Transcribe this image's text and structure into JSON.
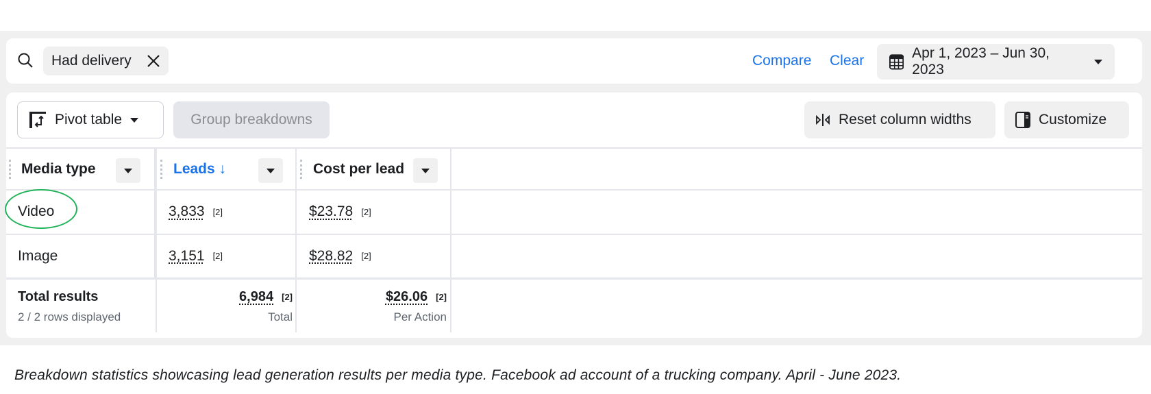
{
  "filter_bar": {
    "search_icon": "search-icon",
    "chip_label": "Had delivery",
    "compare_label": "Compare",
    "clear_label": "Clear",
    "date_range": "Apr 1, 2023 – Jun 30, 2023",
    "link_color": "#1a73e8"
  },
  "toolbar": {
    "pivot_label": "Pivot table",
    "group_label": "Group breakdowns",
    "reset_label": "Reset column widths",
    "customize_label": "Customize"
  },
  "table": {
    "columns": [
      "Media type",
      "Leads ↓",
      "Cost per lead"
    ],
    "rows": [
      {
        "media": "Video",
        "leads": "3,833",
        "leads_fn": "[2]",
        "cpl": "$23.78",
        "cpl_fn": "[2]"
      },
      {
        "media": "Image",
        "leads": "3,151",
        "leads_fn": "[2]",
        "cpl": "$28.82",
        "cpl_fn": "[2]"
      }
    ],
    "total": {
      "label": "Total results",
      "sub": "2 / 2 rows displayed",
      "leads": "6,984",
      "leads_fn": "[2]",
      "leads_sub": "Total",
      "cpl": "$26.06",
      "cpl_fn": "[2]",
      "cpl_sub": "Per Action"
    },
    "highlight_color": "#21b35a"
  },
  "caption": "Breakdown statistics showcasing lead generation results per media type. Facebook ad account of a trucking company. April - June 2023."
}
